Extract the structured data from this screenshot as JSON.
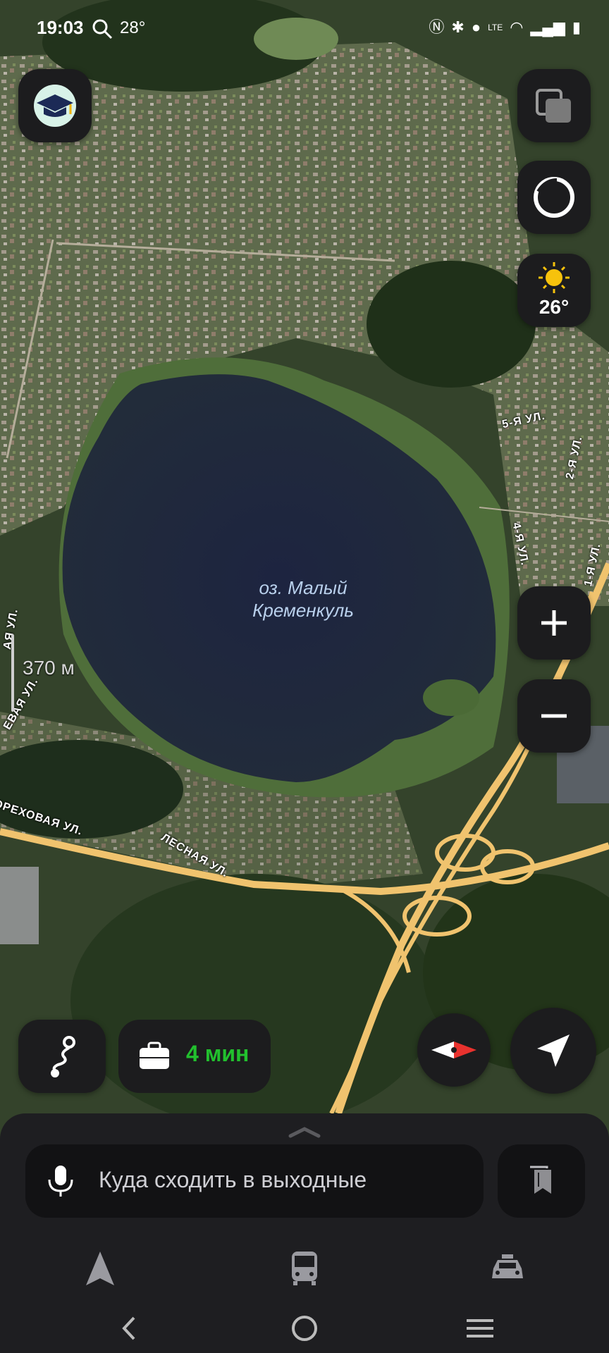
{
  "status_bar": {
    "time": "19:03",
    "temperature": "28°",
    "icons": [
      "search-icon",
      "nfc-icon",
      "bluetooth-icon",
      "location-icon",
      "volte-icon",
      "wifi-icon",
      "signal-icon",
      "battery-icon"
    ]
  },
  "map": {
    "lake_label_line1": "оз. Малый",
    "lake_label_line2": "Кременкуль",
    "scale_label": "370 м",
    "streets": [
      "5-Я УЛ.",
      "2-Я УЛ.",
      "4-Я УЛ.",
      "1-Я УЛ.",
      "ЛЕСНАЯ УЛ.",
      "ОРЕХОВАЯ УЛ.",
      "ЕВАЯ УЛ.",
      "АЯ УЛ."
    ],
    "map_style": "satellite"
  },
  "controls": {
    "weather_temp": "26°",
    "eta_label": "4 мин",
    "eta_color": "#22c02e"
  },
  "bottom_sheet": {
    "search_placeholder": "Куда сходить в выходные",
    "tabs": [
      "navigator-icon",
      "bus-icon",
      "taxi-icon"
    ]
  }
}
